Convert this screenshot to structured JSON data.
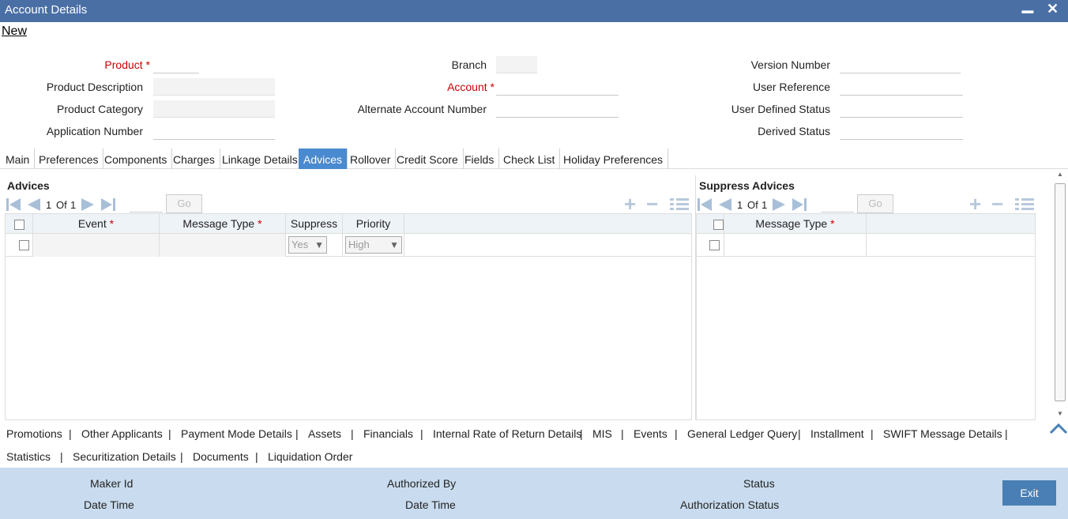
{
  "window": {
    "title": "Account Details",
    "minimize": "▁",
    "close": "✕"
  },
  "menu": {
    "new": "New"
  },
  "header": {
    "product_label": "Product",
    "product_desc_label": "Product Description",
    "product_cat_label": "Product Category",
    "app_num_label": "Application Number",
    "branch_label": "Branch",
    "account_label": "Account",
    "alt_acct_label": "Alternate Account Number",
    "version_label": "Version Number",
    "user_ref_label": "User Reference",
    "udf_status_label": "User Defined Status",
    "derived_status_label": "Derived Status",
    "required_mark": "*"
  },
  "tabs": [
    "Main",
    "Preferences",
    "Components",
    "Charges",
    "Linkage Details",
    "Advices",
    "Rollover",
    "Credit Score",
    "Fields",
    "Check List",
    "Holiday Preferences"
  ],
  "active_tab": "Advices",
  "advices": {
    "title": "Advices",
    "page": "1",
    "of": "Of",
    "total": "1",
    "go": "Go",
    "cols": {
      "event": "Event",
      "message_type": "Message Type",
      "suppress": "Suppress",
      "priority": "Priority"
    },
    "row": {
      "suppress": "Yes",
      "priority": "High"
    }
  },
  "suppress_advices": {
    "title": "Suppress Advices",
    "page": "1",
    "of": "Of",
    "total": "1",
    "go": "Go",
    "cols": {
      "message_type": "Message Type"
    }
  },
  "footer_links": [
    "Promotions",
    "Other Applicants",
    "Payment Mode Details",
    "Assets",
    "Financials",
    "Internal Rate of Return Details",
    "MIS",
    "Events",
    "General Ledger Query",
    "Installment",
    "SWIFT Message Details",
    "Statistics",
    "Securitization Details",
    "Documents",
    "Liquidation Order"
  ],
  "footer_sep": "|",
  "bottom": {
    "maker_id": "Maker Id",
    "date_time": "Date Time",
    "authorized_by": "Authorized By",
    "date_time2": "Date Time",
    "status": "Status",
    "auth_status": "Authorization Status",
    "exit": "Exit"
  },
  "colors": {
    "titlebar": "#4a6fa5",
    "active_tab": "#4a8ad0",
    "bottom_bar": "#c9dcef",
    "required": "#cc0000"
  }
}
